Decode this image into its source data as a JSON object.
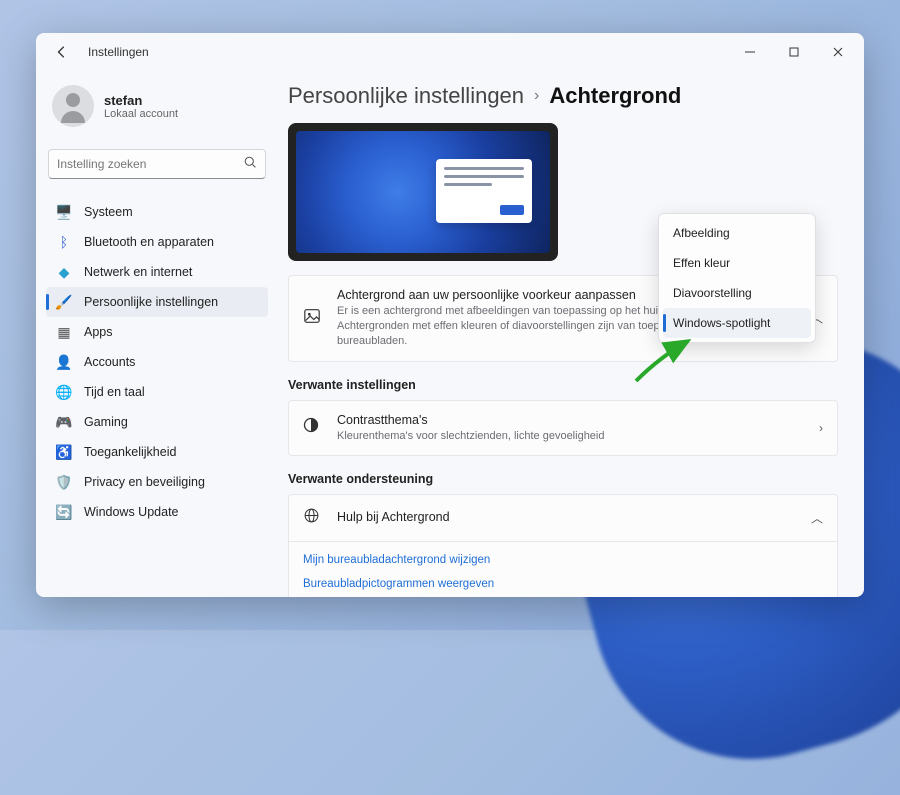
{
  "app_title": "Instellingen",
  "user": {
    "name": "stefan",
    "subtitle": "Lokaal account"
  },
  "search": {
    "placeholder": "Instelling zoeken"
  },
  "nav": [
    {
      "icon": "🖥️",
      "label": "Systeem",
      "color": "#2a5fd0"
    },
    {
      "icon": "ᛒ",
      "label": "Bluetooth en apparaten",
      "color": "#2a5fd0"
    },
    {
      "icon": "◆",
      "label": "Netwerk en internet",
      "color": "#2aa0d0"
    },
    {
      "icon": "🖌️",
      "label": "Persoonlijke instellingen",
      "color": "#d07a2a",
      "active": true
    },
    {
      "icon": "▦",
      "label": "Apps",
      "color": "#555"
    },
    {
      "icon": "👤",
      "label": "Accounts",
      "color": "#4aa04a"
    },
    {
      "icon": "🌐",
      "label": "Tijd en taal",
      "color": "#5a8ad0"
    },
    {
      "icon": "🎮",
      "label": "Gaming",
      "color": "#6a6a6a"
    },
    {
      "icon": "♿",
      "label": "Toegankelijkheid",
      "color": "#2a5fd0"
    },
    {
      "icon": "🛡️",
      "label": "Privacy en beveiliging",
      "color": "#555"
    },
    {
      "icon": "🔄",
      "label": "Windows Update",
      "color": "#2a9fd0"
    }
  ],
  "breadcrumb": {
    "parent": "Persoonlijke instellingen",
    "current": "Achtergrond"
  },
  "bgcard": {
    "title": "Achtergrond aan uw persoonlijke voorkeur aanpassen",
    "sub": "Er is een achtergrond met afbeeldingen van toepassing op het huidige bureaublad. Achtergronden met effen kleuren of diavoorstellingen zijn van toepassing op al uw bureaubladen."
  },
  "dropdown": [
    "Afbeelding",
    "Effen kleur",
    "Diavoorstelling",
    "Windows-spotlight"
  ],
  "dropdown_selected": 3,
  "section_related": "Verwante instellingen",
  "contrast": {
    "title": "Contrastthema's",
    "sub": "Kleurenthema's voor slechtzienden, lichte gevoeligheid"
  },
  "section_support": "Verwante ondersteuning",
  "help": {
    "title": "Hulp bij Achtergrond"
  },
  "help_links": [
    "Mijn bureaubladachtergrond wijzigen",
    "Bureaubladpictogrammen weergeven"
  ]
}
